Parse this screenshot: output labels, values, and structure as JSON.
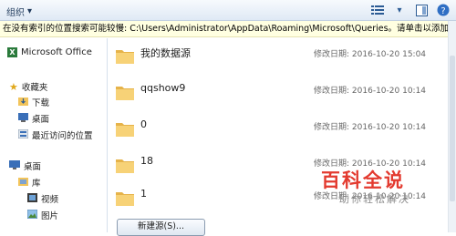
{
  "toolbar": {
    "organize_label": "组织",
    "icons": [
      "view-icon",
      "preview-pane-icon",
      "help-icon"
    ]
  },
  "info_bar": {
    "text": "在没有索引的位置搜索可能较慢: C:\\Users\\Administrator\\AppData\\Roaming\\Microsoft\\Queries。请单击以添加..."
  },
  "nav": {
    "ms_office": "Microsoft Office",
    "favorites": "收藏夹",
    "downloads": "下载",
    "desktop_fav": "桌面",
    "recent": "最近访问的位置",
    "desktop": "桌面",
    "libraries": "库",
    "videos": "视频",
    "pictures": "图片"
  },
  "files": [
    {
      "name": "我的数据源",
      "date_label": "修改日期:",
      "date": "2016-10-20 15:04"
    },
    {
      "name": "qqshow9",
      "date_label": "修改日期:",
      "date": "2016-10-20 10:14"
    },
    {
      "name": "0",
      "date_label": "修改日期:",
      "date": "2016-10-20 10:14"
    },
    {
      "name": "18",
      "date_label": "修改日期:",
      "date": "2016-10-20 10:14"
    },
    {
      "name": "1",
      "date_label": "修改日期:",
      "date": "2016-10-20 10:14"
    }
  ],
  "new_source_button": "新建源(S)...",
  "watermark": {
    "logo": "百科全说",
    "subtitle": "助你轻松解决"
  },
  "colors": {
    "info_bg": "#ffffe1",
    "folder": "#f2c45b",
    "accent": "#2b5b94",
    "watermark": "#e33a2f"
  }
}
